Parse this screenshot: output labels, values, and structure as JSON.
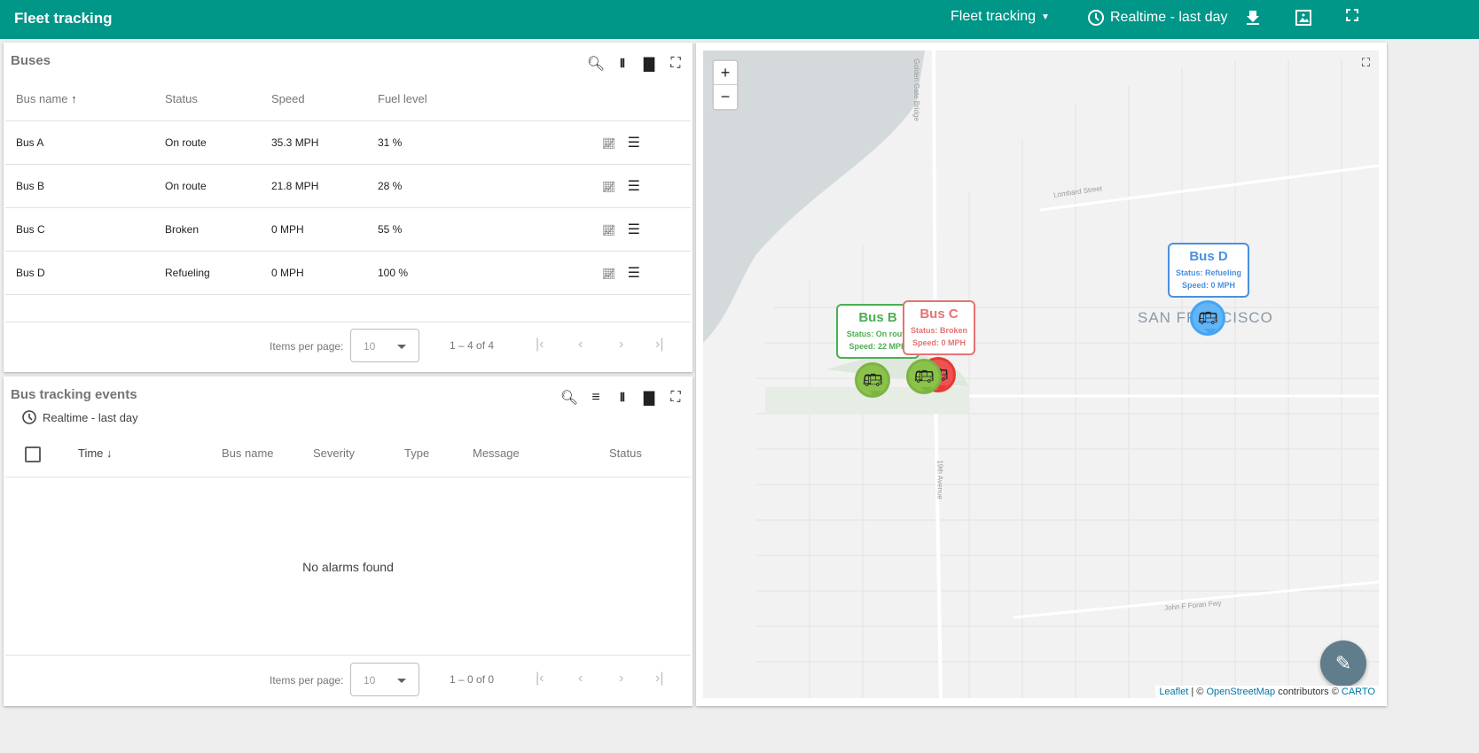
{
  "header": {
    "title": "Fleet tracking",
    "dashboard_select": "Fleet tracking",
    "timewindow": "Realtime - last day",
    "icons": [
      "download-icon",
      "image-export-icon",
      "fullscreen-icon"
    ],
    "color": "#009688"
  },
  "buses": {
    "title": "Buses",
    "columns": [
      "Bus name",
      "Status",
      "Speed",
      "Fuel level"
    ],
    "rows": [
      {
        "name": "Bus A",
        "status": "On route",
        "speed": "35.3 MPH",
        "fuel": "31 %"
      },
      {
        "name": "Bus B",
        "status": "On route",
        "speed": "21.8 MPH",
        "fuel": "28 %"
      },
      {
        "name": "Bus C",
        "status": "Broken",
        "speed": "0 MPH",
        "fuel": "55 %"
      },
      {
        "name": "Bus D",
        "status": "Refueling",
        "speed": "0 MPH",
        "fuel": "100 %"
      }
    ],
    "items_per_page_label": "Items per page:",
    "items_per_page": "10",
    "range": "1 – 4 of 4"
  },
  "events": {
    "title": "Bus tracking events",
    "timewindow": "Realtime - last day",
    "columns": [
      "Time",
      "Bus name",
      "Severity",
      "Type",
      "Message",
      "Status"
    ],
    "empty": "No alarms found",
    "items_per_page_label": "Items per page:",
    "items_per_page": "10",
    "range": "1 – 0 of 0"
  },
  "map": {
    "zoom_in": "+",
    "zoom_out": "−",
    "city_label": "SAN FRANCISCO",
    "streets": [
      "Lombard Street",
      "19th Avenue",
      "John F Foran Fwy",
      "Golden Gate Bridge"
    ],
    "markers": [
      {
        "name": "Bus B",
        "status": "Status: On route",
        "speed": "Speed: 22 MPH",
        "color": "#4caf50"
      },
      {
        "name": "Bus C",
        "status": "Status: Broken",
        "speed": "Speed: 0 MPH",
        "color": "#e57373"
      },
      {
        "name": "Bus D",
        "status": "Status: Refueling",
        "speed": "Speed: 0 MPH",
        "color": "#4a90e2"
      }
    ],
    "attribution": {
      "leaflet": "Leaflet",
      "sep": " | © ",
      "osm": "OpenStreetMap",
      "contrib": " contributors © ",
      "carto": "CARTO"
    }
  }
}
